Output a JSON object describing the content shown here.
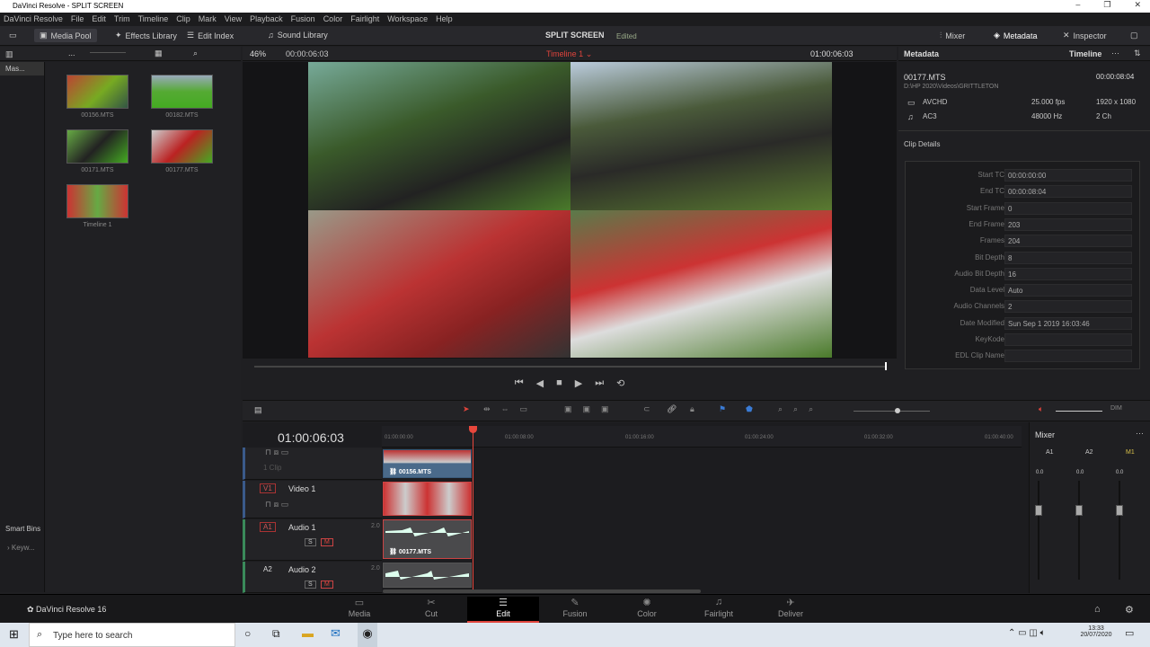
{
  "window": {
    "title": "DaVinci Resolve - SPLIT SCREEN",
    "controls": [
      "–",
      "❐",
      "✕"
    ]
  },
  "menu": [
    "DaVinci Resolve",
    "File",
    "Edit",
    "Trim",
    "Timeline",
    "Clip",
    "Mark",
    "View",
    "Playback",
    "Fusion",
    "Color",
    "Fairlight",
    "Workspace",
    "Help"
  ],
  "toolbar": {
    "media_pool": "Media Pool",
    "effects_library": "Effects Library",
    "edit_index": "Edit Index",
    "sound_library": "Sound Library",
    "project_title": "SPLIT SCREEN",
    "project_status": "Edited",
    "mixer": "Mixer",
    "metadata": "Metadata",
    "inspector": "Inspector"
  },
  "media_pool": {
    "bin_master": "Mas...",
    "ellipsis": "...",
    "clips": [
      {
        "name": "00156.MTS"
      },
      {
        "name": "00182.MTS"
      },
      {
        "name": "00171.MTS"
      },
      {
        "name": "00177.MTS"
      },
      {
        "name": "Timeline 1"
      }
    ],
    "smart_bins": "Smart Bins",
    "keywords": "Keyw..."
  },
  "viewer": {
    "zoom": "46%",
    "source_tc": "00:00:06:03",
    "timeline_name": "Timeline 1",
    "timecode": "01:00:06:03"
  },
  "metadata": {
    "header": "Metadata",
    "context": "Timeline",
    "clip_name": "00177.MTS",
    "duration": "00:00:08:04",
    "path": "D:\\HP 2020\\Videos\\GRITTLETON",
    "video_codec": "AVCHD",
    "fps": "25.000 fps",
    "resolution": "1920 x 1080",
    "audio_codec": "AC3",
    "sample_rate": "48000 Hz",
    "channels": "2 Ch",
    "section": "Clip Details",
    "fields": [
      {
        "k": "Start TC",
        "v": "00:00:00:00"
      },
      {
        "k": "End TC",
        "v": "00:00:08:04"
      },
      {
        "k": "Start Frame",
        "v": "0"
      },
      {
        "k": "End Frame",
        "v": "203"
      },
      {
        "k": "Frames",
        "v": "204"
      },
      {
        "k": "Bit Depth",
        "v": "8"
      },
      {
        "k": "Audio Bit Depth",
        "v": "16"
      },
      {
        "k": "Data Level",
        "v": "Auto"
      },
      {
        "k": "Audio Channels",
        "v": "2"
      },
      {
        "k": "Date Modified",
        "v": "Sun Sep 1 2019 16:03:46"
      },
      {
        "k": "KeyKode",
        "v": ""
      },
      {
        "k": "EDL Clip Name",
        "v": ""
      }
    ]
  },
  "timeline": {
    "timecode": "01:00:06:03",
    "ruler": [
      "01:00:00:00",
      "01:00:08:00",
      "01:00:16:00",
      "01:00:24:00",
      "01:00:32:00",
      "01:00:40:00"
    ],
    "tracks": {
      "v2_info": "1 Clip",
      "v1_badge": "V1",
      "v1_name": "Video 1",
      "a1_badge": "A1",
      "a1_name": "Audio 1",
      "a1_level": "2.0",
      "a2_badge": "A2",
      "a2_name": "Audio 2",
      "a2_level": "2.0",
      "solo": "S",
      "mute": "M"
    },
    "clips": {
      "v2": "00156.MTS",
      "a1": "00177.MTS"
    }
  },
  "mixer": {
    "title": "Mixer",
    "channels": [
      "A1",
      "A2",
      "M1"
    ],
    "levels": [
      "0.0",
      "0.0",
      "0.0"
    ]
  },
  "pages": {
    "brand": "DaVinci Resolve 16",
    "tabs": [
      "Media",
      "Cut",
      "Edit",
      "Fusion",
      "Color",
      "Fairlight",
      "Deliver"
    ],
    "active": "Edit"
  },
  "taskbar": {
    "search_placeholder": "Type here to search",
    "time": "13:33",
    "date": "20/07/2020"
  },
  "colors": {
    "accent_red": "#e0443c",
    "playhead": "#e8473c"
  }
}
